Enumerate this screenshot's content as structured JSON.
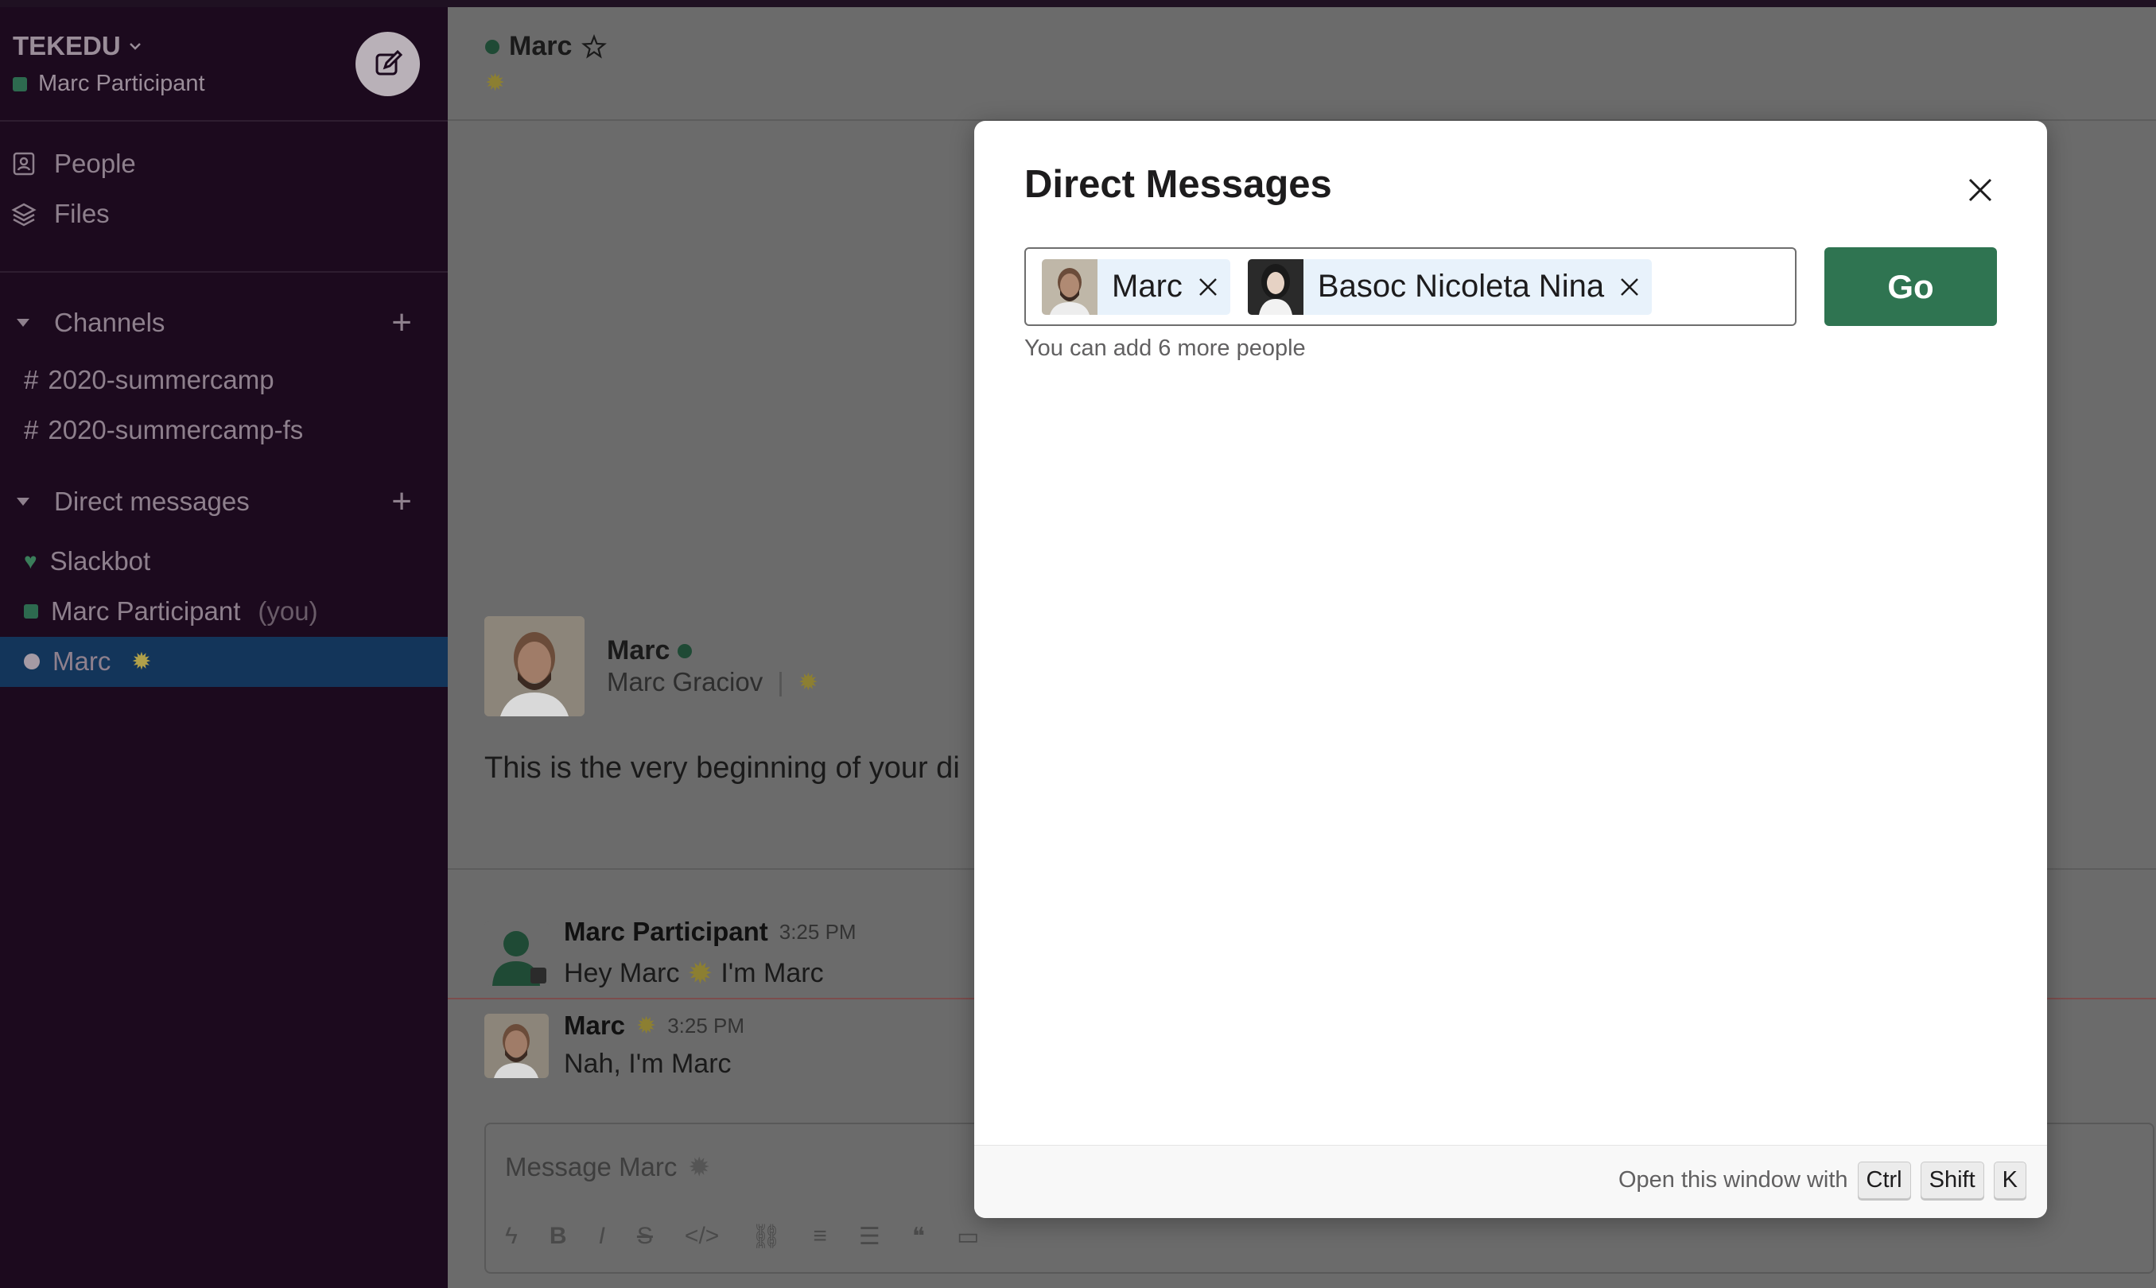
{
  "workspace": {
    "name": "TEKEDU",
    "user": "Marc Participant"
  },
  "sidebar": {
    "nav": [
      {
        "label": "People",
        "icon": "people-icon"
      },
      {
        "label": "Files",
        "icon": "files-icon"
      }
    ],
    "channels_header": "Channels",
    "channels": [
      "2020-summercamp",
      "2020-summercamp-fs"
    ],
    "dms_header": "Direct messages",
    "dms": [
      {
        "label": "Slackbot"
      },
      {
        "label": "Marc Participant",
        "suffix": "(you)"
      },
      {
        "label": "Marc"
      }
    ]
  },
  "channel": {
    "title": "Marc"
  },
  "intro": {
    "name": "Marc",
    "full_name": "Marc Graciov",
    "separator": "|",
    "text": "This is the very beginning of your di"
  },
  "messages": [
    {
      "author": "Marc Participant",
      "time": "3:25 PM",
      "text_before": "Hey Marc",
      "text_after": "I'm Marc"
    },
    {
      "author": "Marc",
      "time": "3:25 PM",
      "text": "Nah, I'm Marc"
    }
  ],
  "composer": {
    "placeholder": "Message Marc"
  },
  "modal": {
    "title": "Direct Messages",
    "recipients": [
      "Marc",
      "Basoc Nicoleta Nina"
    ],
    "hint": "You can add 6 more people",
    "go_label": "Go",
    "footer_text": "Open this window with",
    "shortcut": [
      "Ctrl",
      "Shift",
      "K"
    ]
  },
  "colors": {
    "sidebar_bg": "#1c0a1e",
    "active_dm": "#13355a",
    "go_button": "#2f7451",
    "online": "#2d6a4f"
  }
}
